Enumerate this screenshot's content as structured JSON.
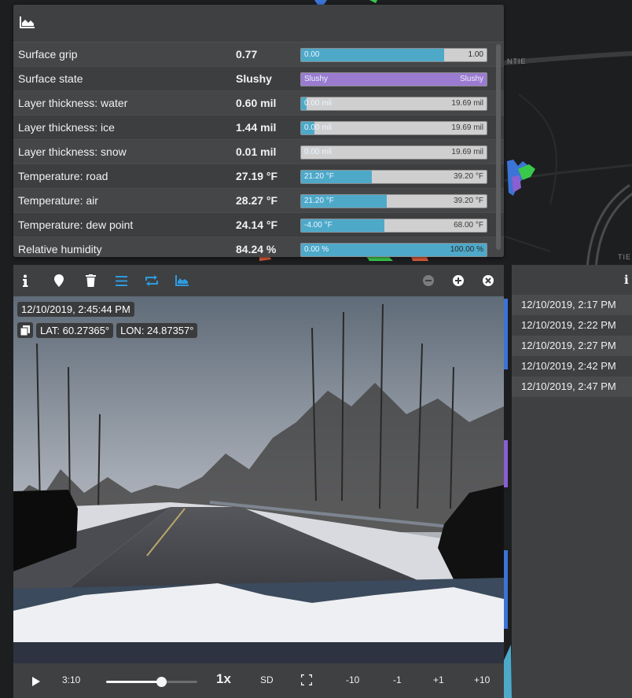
{
  "metrics": {
    "rows": [
      {
        "label": "Surface grip",
        "value": "0.77",
        "bar_min": "0.00",
        "bar_max": "1.00",
        "fraction": 0.77,
        "color": "#4ea9c9",
        "fill_full": true
      },
      {
        "label": "Surface state",
        "value": "Slushy",
        "bar_min": "Slushy",
        "bar_max": "Slushy",
        "fraction": 1.0,
        "color": "#9a7bd0",
        "fill_full": true
      },
      {
        "label": "Layer thickness: water",
        "value": "0.60 mil",
        "bar_min": "0.00 mil",
        "bar_max": "19.69 mil",
        "fraction": 0.03,
        "color": "#4ea9c9"
      },
      {
        "label": "Layer thickness: ice",
        "value": "1.44 mil",
        "bar_min": "0.00 mil",
        "bar_max": "19.69 mil",
        "fraction": 0.07,
        "color": "#4ea9c9"
      },
      {
        "label": "Layer thickness: snow",
        "value": "0.01 mil",
        "bar_min": "0.00 mil",
        "bar_max": "19.69 mil",
        "fraction": 0.0,
        "color": "#4ea9c9"
      },
      {
        "label": "Temperature: road",
        "value": "27.19 °F",
        "bar_min": "21.20 °F",
        "bar_max": "39.20 °F",
        "fraction": 0.38,
        "color": "#4ea9c9"
      },
      {
        "label": "Temperature: air",
        "value": "28.27 °F",
        "bar_min": "21.20 °F",
        "bar_max": "39.20 °F",
        "fraction": 0.46,
        "color": "#4ea9c9"
      },
      {
        "label": "Temperature: dew point",
        "value": "24.14 °F",
        "bar_min": "-4.00 °F",
        "bar_max": "68.00 °F",
        "fraction": 0.45,
        "color": "#4ea9c9"
      },
      {
        "label": "Relative humidity",
        "value": "84.24 %",
        "bar_min": "0.00 %",
        "bar_max": "100.00 %",
        "fraction": 1.0,
        "color": "#4ea9c9",
        "fill_full": true
      }
    ]
  },
  "video": {
    "timestamp": "12/10/2019, 2:45:44 PM",
    "lat": "LAT: 60.27365°",
    "lon": "LON: 24.87357°",
    "time": "3:10",
    "progress": 0.6,
    "speed": "1x",
    "quality": "SD",
    "skip_back_10": "-10",
    "skip_back_1": "-1",
    "skip_fwd_1": "+1",
    "skip_fwd_10": "+10"
  },
  "timeline": {
    "items": [
      "12/10/2019, 2:17 PM",
      "12/10/2019, 2:22 PM",
      "12/10/2019, 2:27 PM",
      "12/10/2019, 2:42 PM",
      "12/10/2019, 2:47 PM"
    ]
  },
  "map_labels": {
    "a": "NTIE",
    "b": "TIE"
  }
}
